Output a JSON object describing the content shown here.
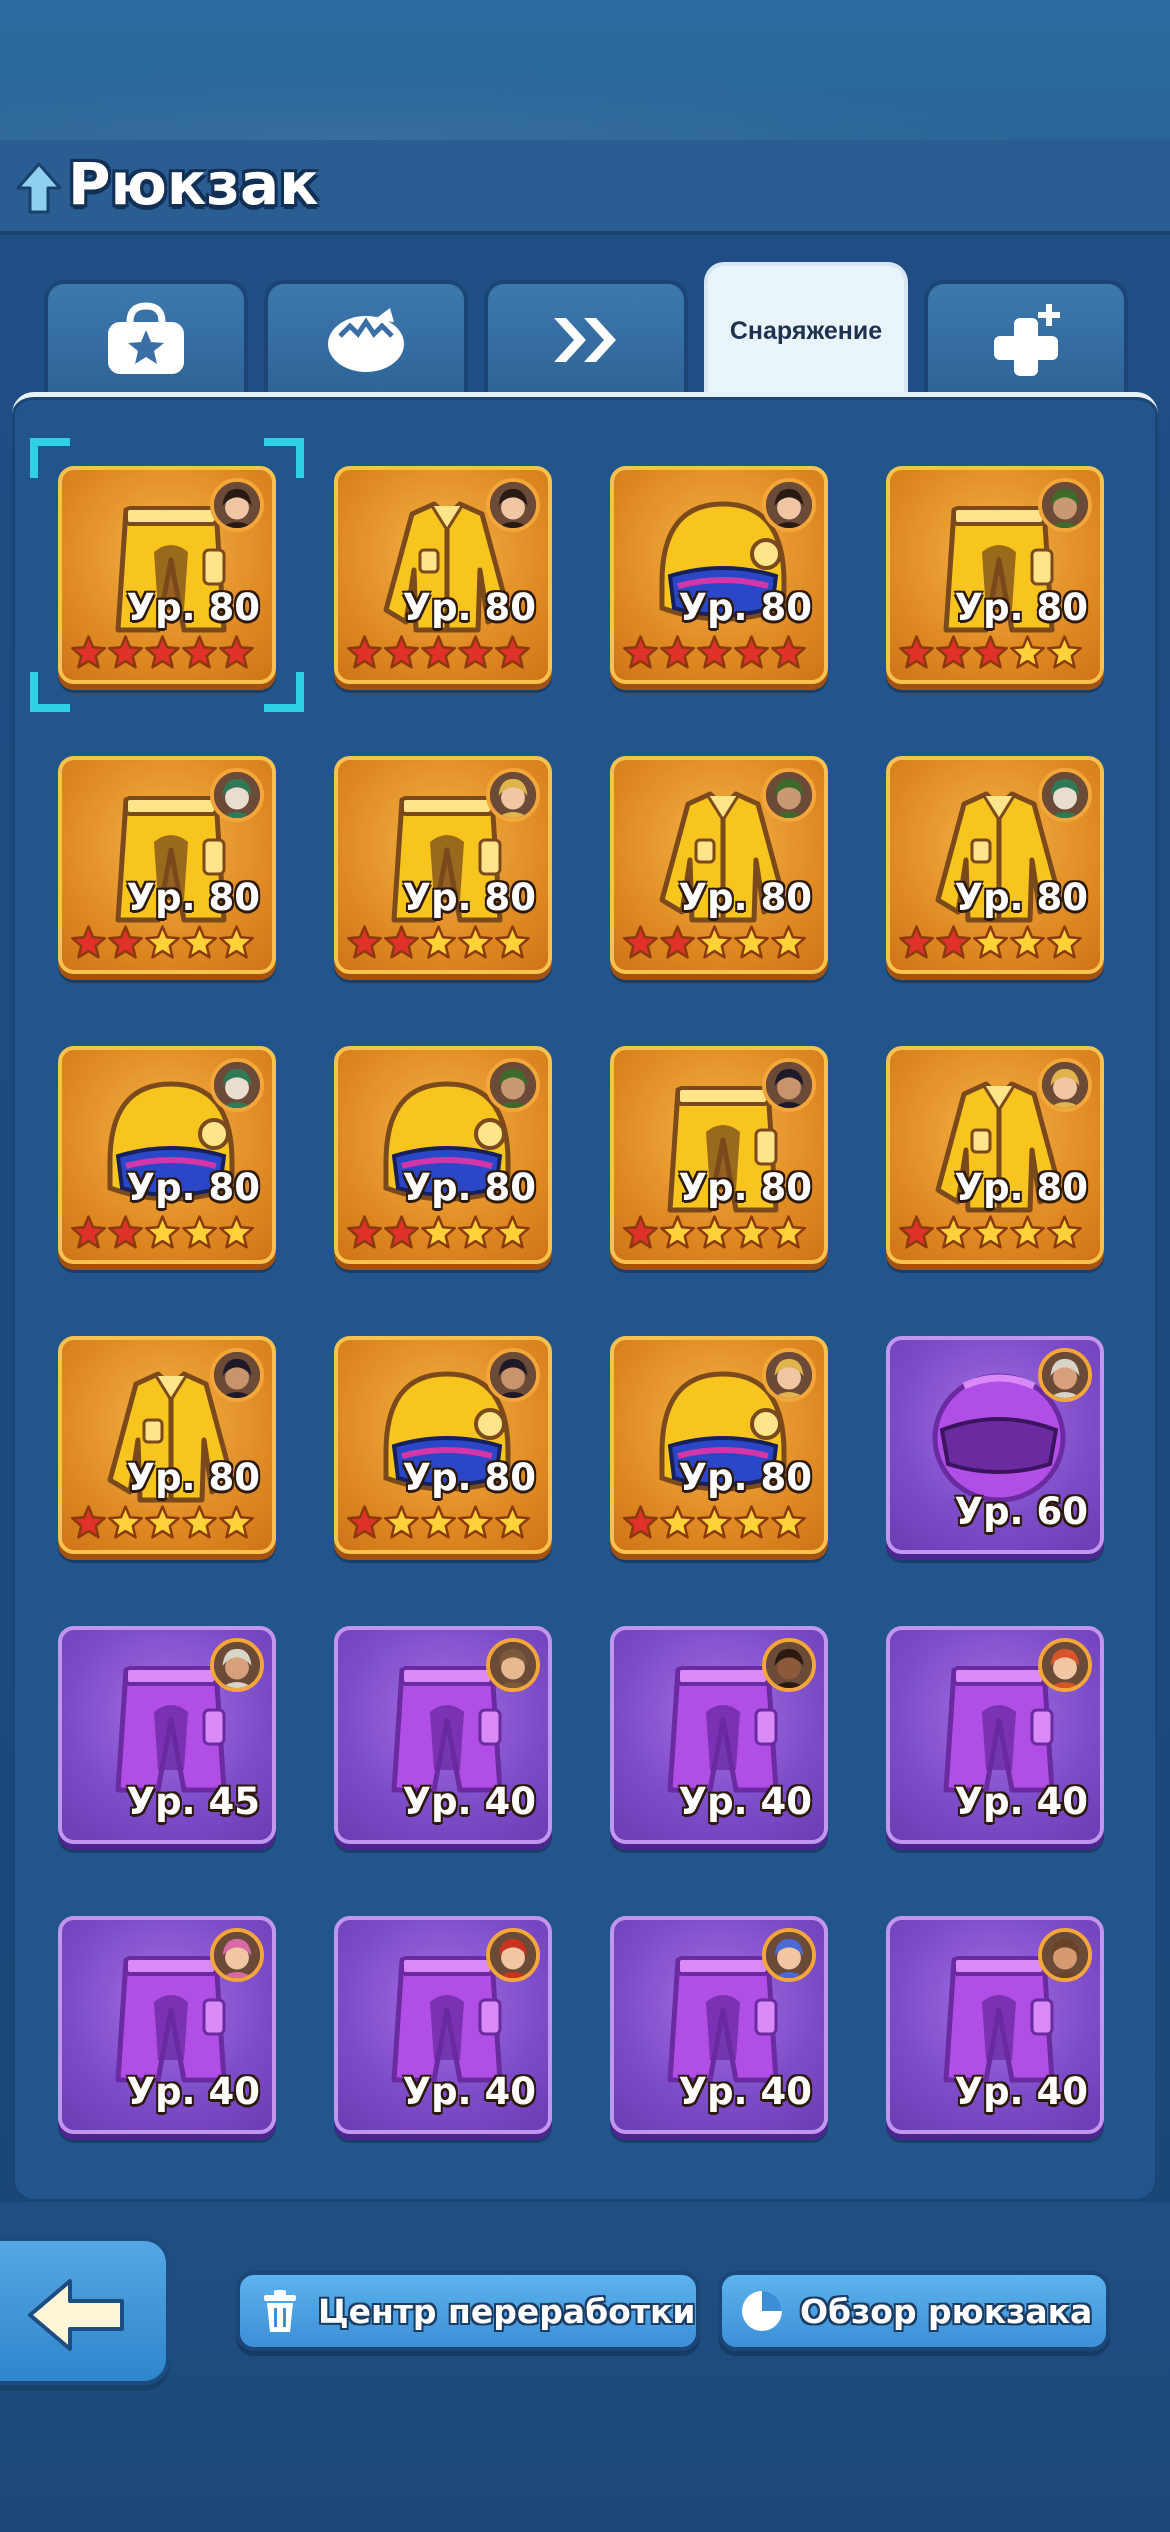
{
  "header": {
    "title": "Рюкзак"
  },
  "tabs": [
    {
      "id": "bag",
      "label": "",
      "icon": "bag-star-icon"
    },
    {
      "id": "eggs",
      "label": "",
      "icon": "egg-icon"
    },
    {
      "id": "boost",
      "label": "",
      "icon": "double-chevron-icon"
    },
    {
      "id": "gear",
      "label": "Снаряжение",
      "icon": "",
      "active": true
    },
    {
      "id": "extra",
      "label": "",
      "icon": "plus-puzzle-icon"
    }
  ],
  "items": [
    {
      "type": "pants",
      "rarity": "gold",
      "level": "Ур. 80",
      "red_stars": 5,
      "stars": 5,
      "selected": true,
      "hero": "female-dark-hair"
    },
    {
      "type": "jacket",
      "rarity": "gold",
      "level": "Ур. 80",
      "red_stars": 5,
      "stars": 5,
      "hero": "female-dark-hair"
    },
    {
      "type": "helmet",
      "rarity": "gold",
      "level": "Ур. 80",
      "red_stars": 5,
      "stars": 5,
      "hero": "female-dark-hair"
    },
    {
      "type": "pants",
      "rarity": "gold",
      "level": "Ур. 80",
      "red_stars": 3,
      "stars": 5,
      "hero": "green-hood"
    },
    {
      "type": "pants",
      "rarity": "gold",
      "level": "Ур. 80",
      "red_stars": 2,
      "stars": 5,
      "hero": "joker"
    },
    {
      "type": "pants",
      "rarity": "gold",
      "level": "Ур. 80",
      "red_stars": 2,
      "stars": 5,
      "hero": "blonde-man"
    },
    {
      "type": "jacket",
      "rarity": "gold",
      "level": "Ур. 80",
      "red_stars": 2,
      "stars": 5,
      "hero": "green-hood"
    },
    {
      "type": "jacket",
      "rarity": "gold",
      "level": "Ур. 80",
      "red_stars": 2,
      "stars": 5,
      "hero": "joker"
    },
    {
      "type": "helmet",
      "rarity": "gold",
      "level": "Ур. 80",
      "red_stars": 2,
      "stars": 5,
      "hero": "joker"
    },
    {
      "type": "helmet",
      "rarity": "gold",
      "level": "Ур. 80",
      "red_stars": 2,
      "stars": 5,
      "hero": "green-hood"
    },
    {
      "type": "pants",
      "rarity": "gold",
      "level": "Ур. 80",
      "red_stars": 1,
      "stars": 5,
      "hero": "dark-curly-hair"
    },
    {
      "type": "jacket",
      "rarity": "gold",
      "level": "Ур. 80",
      "red_stars": 1,
      "stars": 5,
      "hero": "blonde-man"
    },
    {
      "type": "jacket",
      "rarity": "gold",
      "level": "Ур. 80",
      "red_stars": 1,
      "stars": 5,
      "hero": "dark-curly-hair"
    },
    {
      "type": "helmet",
      "rarity": "gold",
      "level": "Ур. 80",
      "red_stars": 1,
      "stars": 5,
      "hero": "dark-curly-hair"
    },
    {
      "type": "helmet",
      "rarity": "gold",
      "level": "Ур. 80",
      "red_stars": 1,
      "stars": 5,
      "hero": "blonde-man"
    },
    {
      "type": "moto-helmet",
      "rarity": "purple",
      "level": "Ур. 60",
      "red_stars": 0,
      "stars": 0,
      "hero": "cap-man"
    },
    {
      "type": "pants",
      "rarity": "purple",
      "level": "Ур. 45",
      "red_stars": 0,
      "stars": 0,
      "hero": "cap-man"
    },
    {
      "type": "pants",
      "rarity": "purple",
      "level": "Ур. 40",
      "red_stars": 0,
      "stars": 0,
      "hero": "goggles-kid"
    },
    {
      "type": "pants",
      "rarity": "purple",
      "level": "Ур. 40",
      "red_stars": 0,
      "stars": 0,
      "hero": "headband-man"
    },
    {
      "type": "pants",
      "rarity": "purple",
      "level": "Ур. 40",
      "red_stars": 0,
      "stars": 0,
      "hero": "redhead-woman"
    },
    {
      "type": "pants",
      "rarity": "purple",
      "level": "Ур. 40",
      "red_stars": 0,
      "stars": 0,
      "hero": "pink-hair-woman"
    },
    {
      "type": "pants",
      "rarity": "purple",
      "level": "Ур. 40",
      "red_stars": 0,
      "stars": 0,
      "hero": "red-hair-woman"
    },
    {
      "type": "pants",
      "rarity": "purple",
      "level": "Ур. 40",
      "red_stars": 0,
      "stars": 0,
      "hero": "blue-hair-man"
    },
    {
      "type": "pants",
      "rarity": "purple",
      "level": "Ур. 40",
      "red_stars": 0,
      "stars": 0,
      "hero": "bearded-man"
    }
  ],
  "footer": {
    "back_icon": "arrow-left-icon",
    "recycle_label": "Центр переработки",
    "recycle_icon": "trash-icon",
    "overview_label": "Обзор рюкзака",
    "overview_icon": "pie-chart-icon"
  },
  "colors": {
    "background": "#1f4f86",
    "gold_card": "#e08b24",
    "purple_card": "#7c4cc8",
    "red_star": "#e0322a",
    "gold_star": "#ffd23a",
    "button_blue": "#3c8fd6"
  }
}
